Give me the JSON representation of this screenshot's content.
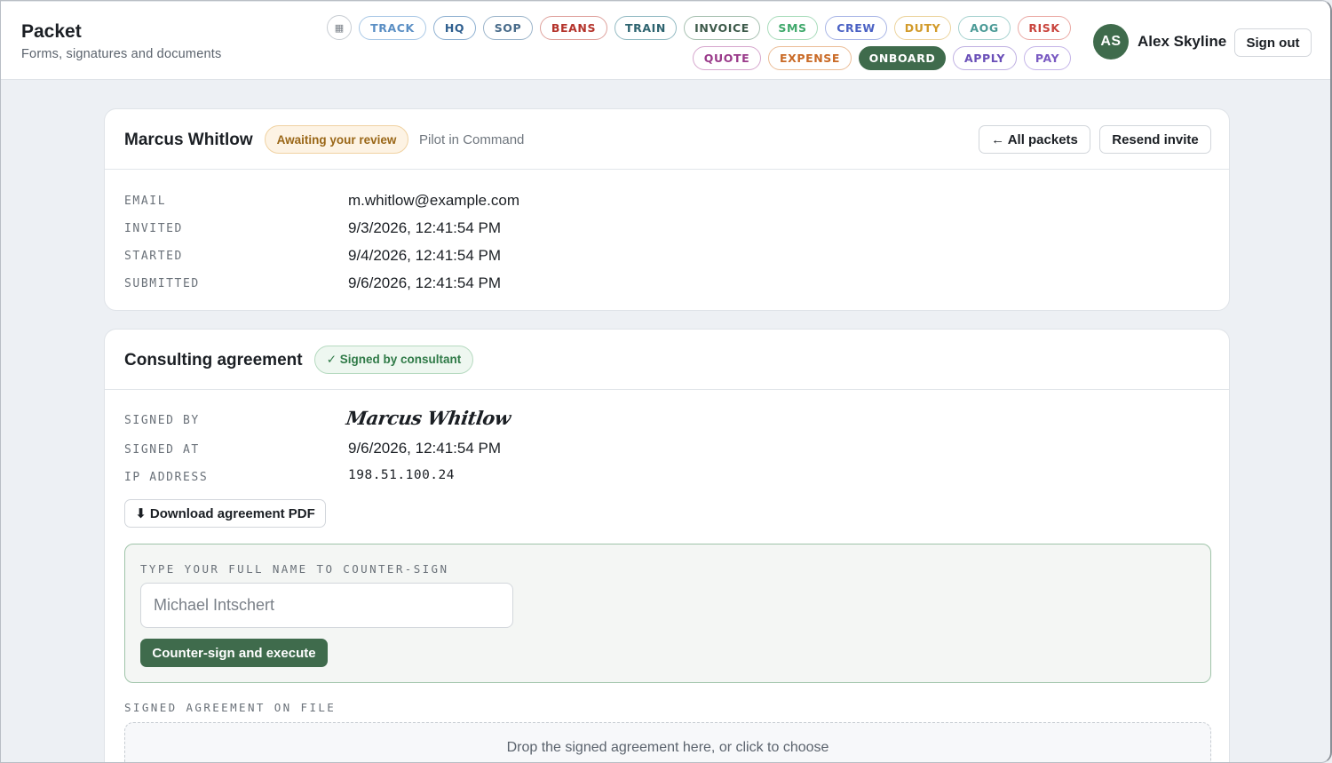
{
  "header": {
    "title": "Packet",
    "subtitle": "Forms, signatures and documents",
    "grid_icon": "grid-icon",
    "nav": [
      {
        "label": "TRACK",
        "color": "#5b8fc4",
        "border": "#a9c8e6"
      },
      {
        "label": "HQ",
        "color": "#2f5f8f",
        "border": "#8eb0d1"
      },
      {
        "label": "SOP",
        "color": "#486b8a",
        "border": "#9bb4ca"
      },
      {
        "label": "BEANS",
        "color": "#b4332b",
        "border": "#dea19c"
      },
      {
        "label": "TRAIN",
        "color": "#2e6470",
        "border": "#92bac2"
      },
      {
        "label": "INVOICE",
        "color": "#3d5a4a",
        "border": "#a6c0b0"
      },
      {
        "label": "SMS",
        "color": "#3fa86b",
        "border": "#a8dcbb"
      },
      {
        "label": "CREW",
        "color": "#4b62c4",
        "border": "#a8b5e6"
      },
      {
        "label": "DUTY",
        "color": "#d29b2b",
        "border": "#ecd49e"
      },
      {
        "label": "AOG",
        "color": "#4a9a96",
        "border": "#a6d2cf"
      },
      {
        "label": "RISK",
        "color": "#c9443d",
        "border": "#eaa9a4"
      },
      {
        "label": "QUOTE",
        "color": "#9a3a8a",
        "border": "#d6a6cd"
      },
      {
        "label": "EXPENSE",
        "color": "#c96a26",
        "border": "#ebbd97"
      },
      {
        "label": "ONBOARD",
        "color": "#ffffff",
        "border": "#3f6b4c",
        "active": true
      },
      {
        "label": "APPLY",
        "color": "#6a4fb8",
        "border": "#bfb0e2"
      },
      {
        "label": "PAY",
        "color": "#7a5ac2",
        "border": "#c4b4e8"
      }
    ],
    "user": {
      "initials": "AS",
      "name": "Alex Skyline"
    },
    "sign_out": "Sign out"
  },
  "packet": {
    "name": "Marcus Whitlow",
    "status": "Awaiting your review",
    "role": "Pilot in Command",
    "all_packets": "← All packets",
    "resend": "Resend invite",
    "fields": [
      {
        "label": "EMAIL",
        "value": "m.whitlow@example.com"
      },
      {
        "label": "INVITED",
        "value": "9/3/2026, 12:41:54 PM"
      },
      {
        "label": "STARTED",
        "value": "9/4/2026, 12:41:54 PM"
      },
      {
        "label": "SUBMITTED",
        "value": "9/6/2026, 12:41:54 PM"
      }
    ]
  },
  "agreement": {
    "title": "Consulting agreement",
    "status": "✓ Signed by consultant",
    "signed_by_label": "SIGNED BY",
    "signature": "Marcus Whitlow",
    "signed_at_label": "SIGNED AT",
    "signed_at": "9/6/2026, 12:41:54 PM",
    "ip_label": "IP ADDRESS",
    "ip": "198.51.100.24",
    "download": "⬇ Download agreement PDF",
    "countersign": {
      "label": "TYPE YOUR FULL NAME TO COUNTER-SIGN",
      "placeholder": "Michael Intschert",
      "button": "Counter-sign and execute"
    },
    "file_label": "SIGNED AGREEMENT ON FILE",
    "drop_text": "Drop the signed agreement here, or click to choose"
  }
}
